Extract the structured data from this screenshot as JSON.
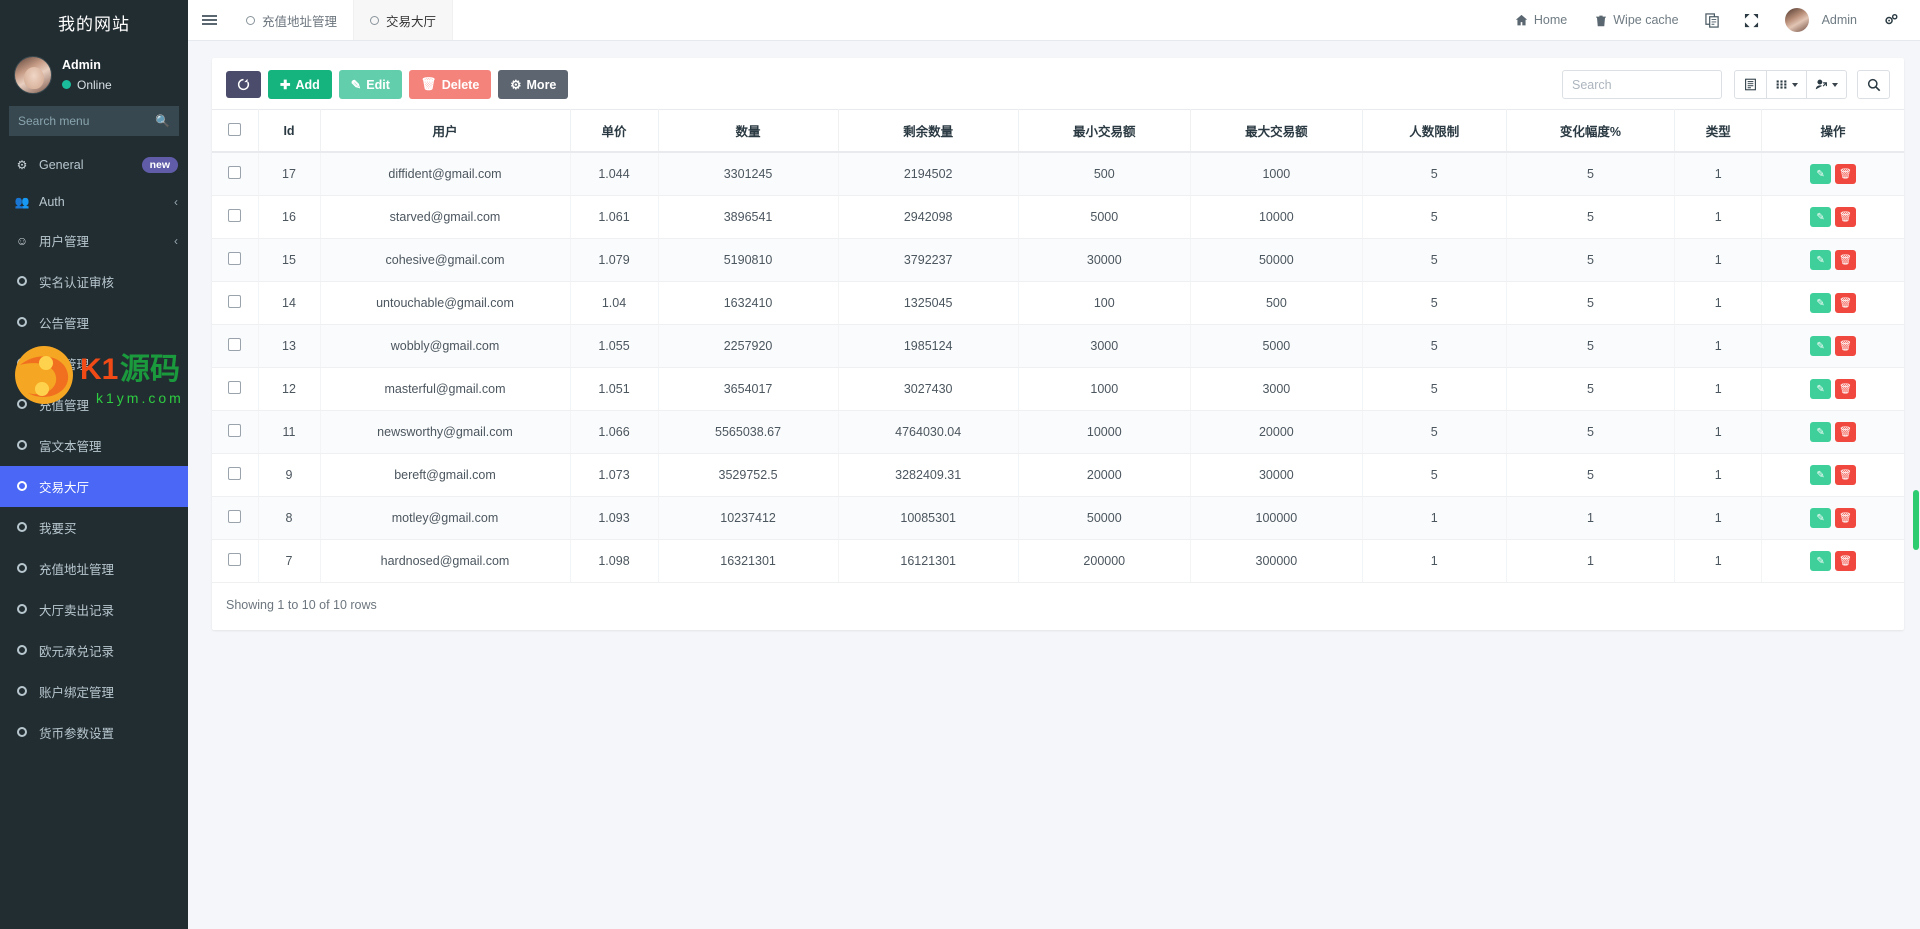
{
  "sidebar": {
    "brand": "我的网站",
    "user": {
      "name": "Admin",
      "status": "Online"
    },
    "search_placeholder": "Search menu",
    "items": [
      {
        "label": "General",
        "icon": "gears-icon",
        "badge": "new",
        "type": "gear",
        "active": false
      },
      {
        "label": "Auth",
        "icon": "users-icon",
        "caret": "‹",
        "type": "users",
        "active": false
      },
      {
        "label": "用户管理",
        "icon": "user-circle-icon",
        "caret": "‹",
        "type": "usercircle",
        "active": false
      },
      {
        "label": "实名认证审核",
        "icon": "circle-icon",
        "type": "circle",
        "active": false
      },
      {
        "label": "公告管理",
        "icon": "circle-icon",
        "type": "circle",
        "active": false
      },
      {
        "label": "核销管理",
        "icon": "circle-icon",
        "type": "circle",
        "active": false
      },
      {
        "label": "充值管理",
        "icon": "circle-icon",
        "type": "circle",
        "active": false
      },
      {
        "label": "富文本管理",
        "icon": "circle-icon",
        "type": "circle",
        "active": false
      },
      {
        "label": "交易大厅",
        "icon": "circle-icon",
        "type": "circle",
        "active": true
      },
      {
        "label": "我要买",
        "icon": "circle-icon",
        "type": "circle",
        "active": false
      },
      {
        "label": "充值地址管理",
        "icon": "circle-icon",
        "type": "circle",
        "active": false
      },
      {
        "label": "大厅卖出记录",
        "icon": "circle-icon",
        "type": "circle",
        "active": false
      },
      {
        "label": "欧元承兑记录",
        "icon": "circle-icon",
        "type": "circle",
        "active": false
      },
      {
        "label": "账户绑定管理",
        "icon": "circle-icon",
        "type": "circle",
        "active": false
      },
      {
        "label": "货币参数设置",
        "icon": "circle-icon",
        "type": "circle",
        "active": false
      }
    ]
  },
  "topbar": {
    "tabs": [
      {
        "label": "充值地址管理",
        "active": false
      },
      {
        "label": "交易大厅",
        "active": true
      }
    ],
    "home_label": "Home",
    "wipe_cache_label": "Wipe cache",
    "user_label": "Admin"
  },
  "toolbar": {
    "refresh_label": "",
    "add_label": "Add",
    "edit_label": "Edit",
    "delete_label": "Delete",
    "more_label": "More",
    "search_placeholder": "Search"
  },
  "table": {
    "columns": [
      "",
      "Id",
      "用户",
      "单价",
      "数量",
      "剩余数量",
      "最小交易额",
      "最大交易额",
      "人数限制",
      "变化幅度%",
      "类型",
      "操作"
    ],
    "rows": [
      {
        "id": "17",
        "user": "diffident@gmail.com",
        "price": "1.044",
        "qty": "3301245",
        "remain": "2194502",
        "min": "500",
        "max": "1000",
        "limit": "5",
        "change": "5",
        "type": "1"
      },
      {
        "id": "16",
        "user": "starved@gmail.com",
        "price": "1.061",
        "qty": "3896541",
        "remain": "2942098",
        "min": "5000",
        "max": "10000",
        "limit": "5",
        "change": "5",
        "type": "1"
      },
      {
        "id": "15",
        "user": "cohesive@gmail.com",
        "price": "1.079",
        "qty": "5190810",
        "remain": "3792237",
        "min": "30000",
        "max": "50000",
        "limit": "5",
        "change": "5",
        "type": "1"
      },
      {
        "id": "14",
        "user": "untouchable@gmail.com",
        "price": "1.04",
        "qty": "1632410",
        "remain": "1325045",
        "min": "100",
        "max": "500",
        "limit": "5",
        "change": "5",
        "type": "1"
      },
      {
        "id": "13",
        "user": "wobbly@gmail.com",
        "price": "1.055",
        "qty": "2257920",
        "remain": "1985124",
        "min": "3000",
        "max": "5000",
        "limit": "5",
        "change": "5",
        "type": "1"
      },
      {
        "id": "12",
        "user": "masterful@gmail.com",
        "price": "1.051",
        "qty": "3654017",
        "remain": "3027430",
        "min": "1000",
        "max": "3000",
        "limit": "5",
        "change": "5",
        "type": "1"
      },
      {
        "id": "11",
        "user": "newsworthy@gmail.com",
        "price": "1.066",
        "qty": "5565038.67",
        "remain": "4764030.04",
        "min": "10000",
        "max": "20000",
        "limit": "5",
        "change": "5",
        "type": "1"
      },
      {
        "id": "9",
        "user": "bereft@gmail.com",
        "price": "1.073",
        "qty": "3529752.5",
        "remain": "3282409.31",
        "min": "20000",
        "max": "30000",
        "limit": "5",
        "change": "5",
        "type": "1"
      },
      {
        "id": "8",
        "user": "motley@gmail.com",
        "price": "1.093",
        "qty": "10237412",
        "remain": "10085301",
        "min": "50000",
        "max": "100000",
        "limit": "1",
        "change": "1",
        "type": "1"
      },
      {
        "id": "7",
        "user": "hardnosed@gmail.com",
        "price": "1.098",
        "qty": "16321301",
        "remain": "16121301",
        "min": "200000",
        "max": "300000",
        "limit": "1",
        "change": "1",
        "type": "1"
      }
    ],
    "footer": "Showing 1 to 10 of 10 rows"
  },
  "watermark": {
    "text_cn": "K1源码",
    "text_url": "k1ym.com"
  },
  "colors": {
    "sidebar_bg": "#222d32",
    "active": "#4a67f5",
    "add": "#15b47e",
    "edit": "#63ceab",
    "delete": "#f4837c",
    "more": "#5d6570",
    "badge": "#605ca8"
  }
}
